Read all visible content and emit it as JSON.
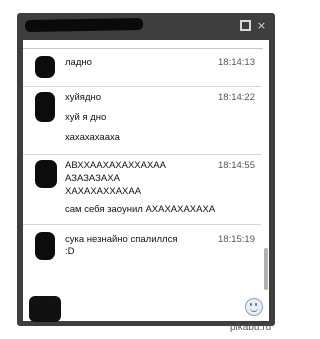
{
  "window": {
    "restore_label": "restore",
    "close_label": "×"
  },
  "messages": [
    {
      "lines": [
        "ладно"
      ],
      "time": "18:14:13"
    },
    {
      "lines": [
        "хуйядно",
        "хуй я дно",
        "хахахахааха"
      ],
      "time": "18:14:22"
    },
    {
      "lines": [
        "АВХХААХАХАХХАХАА",
        "АЗАЗАЗАХА",
        "ХАХАХАХХАХАА",
        "сам себя заоунил АХАХАХАХАХА"
      ],
      "time": "18:14:55"
    },
    {
      "lines": [
        "сука незнайно спалиллся",
        ":D"
      ],
      "time": "18:15:19"
    }
  ],
  "compose": {
    "placeholder": ""
  },
  "icons": {
    "smile": "smiley-icon",
    "close": "close-icon",
    "restore": "restore-icon"
  },
  "watermark": "pikabu.ru"
}
